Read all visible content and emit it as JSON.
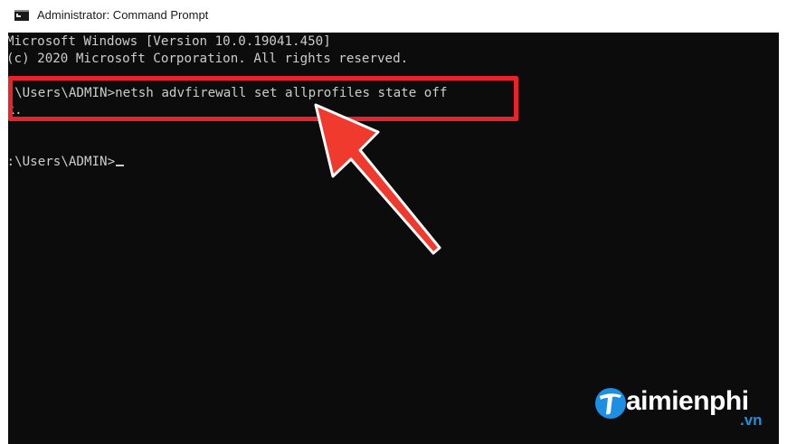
{
  "window": {
    "title": "Administrator: Command Prompt",
    "icon": "command-prompt-icon"
  },
  "console": {
    "lines": [
      "Microsoft Windows [Version 10.0.19041.450]",
      "(c) 2020 Microsoft Corporation. All rights reserved.",
      "",
      "C:\\Users\\ADMIN>netsh advfirewall set allprofiles state off",
      "Ok.",
      "",
      "C:\\Users\\ADMIN>"
    ]
  },
  "annotation": {
    "highlight_color": "#e8232c",
    "arrow_color": "#f03a2e"
  },
  "watermark": {
    "brand": "aimienphi",
    "suffix": ".vn"
  },
  "colors": {
    "console_bg": "#0c0c0c",
    "console_text": "#cccccc",
    "watermark_blue": "#1d8fe3"
  }
}
